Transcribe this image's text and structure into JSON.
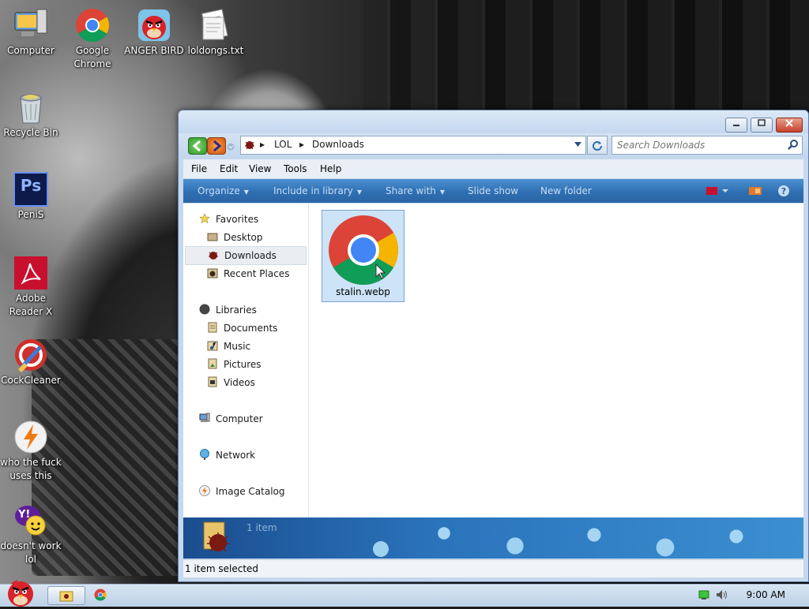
{
  "desktop": {
    "icons": [
      {
        "label": "Computer",
        "icon": "computer-icon"
      },
      {
        "label": "Google Chrome",
        "icon": "chrome-icon"
      },
      {
        "label": "ANGER BIRD",
        "icon": "angry-bird-icon"
      },
      {
        "label": "loldongs.txt",
        "icon": "text-file-icon"
      },
      {
        "label": "Recycle Bin",
        "icon": "recycle-bin-icon"
      },
      {
        "label": "PeniS",
        "icon": "photoshop-icon",
        "badge": "Ps"
      },
      {
        "label": "Adobe Reader X",
        "icon": "adobe-reader-icon"
      },
      {
        "label": "CockCleaner",
        "icon": "ccleaner-icon"
      },
      {
        "label": "who the fuck uses this",
        "icon": "winamp-icon"
      },
      {
        "label": "doesn't work lol",
        "icon": "yahoo-messenger-icon",
        "badge": "Y!"
      }
    ]
  },
  "window": {
    "address": {
      "crumbs": [
        "LOL",
        "Downloads"
      ]
    },
    "search": {
      "placeholder": "Search Downloads"
    },
    "menu": [
      "File",
      "Edit",
      "View",
      "Tools",
      "Help"
    ],
    "toolbar": [
      "Organize",
      "Include in library",
      "Share with",
      "Slide show",
      "New folder"
    ],
    "nav": {
      "favorites": {
        "header": "Favorites",
        "items": [
          "Desktop",
          "Downloads",
          "Recent Places"
        ],
        "selected": "Downloads"
      },
      "libraries": {
        "header": "Libraries",
        "items": [
          "Documents",
          "Music",
          "Pictures",
          "Videos"
        ]
      },
      "computer": "Computer",
      "network": "Network",
      "image_catalog": "Image Catalog"
    },
    "files": [
      {
        "name": "stalin.webp",
        "icon": "chrome-icon"
      }
    ],
    "details": {
      "count": "1 item"
    },
    "status": {
      "text": "1 item selected"
    }
  },
  "taskbar": {
    "clock": "9:00 AM"
  },
  "colors": {
    "accent": "#2f6fb2",
    "selection": "#cde3f8",
    "chrome_red": "#db4437",
    "chrome_green": "#0f9d58",
    "chrome_yellow": "#f4b400",
    "chrome_blue": "#4285f4"
  }
}
